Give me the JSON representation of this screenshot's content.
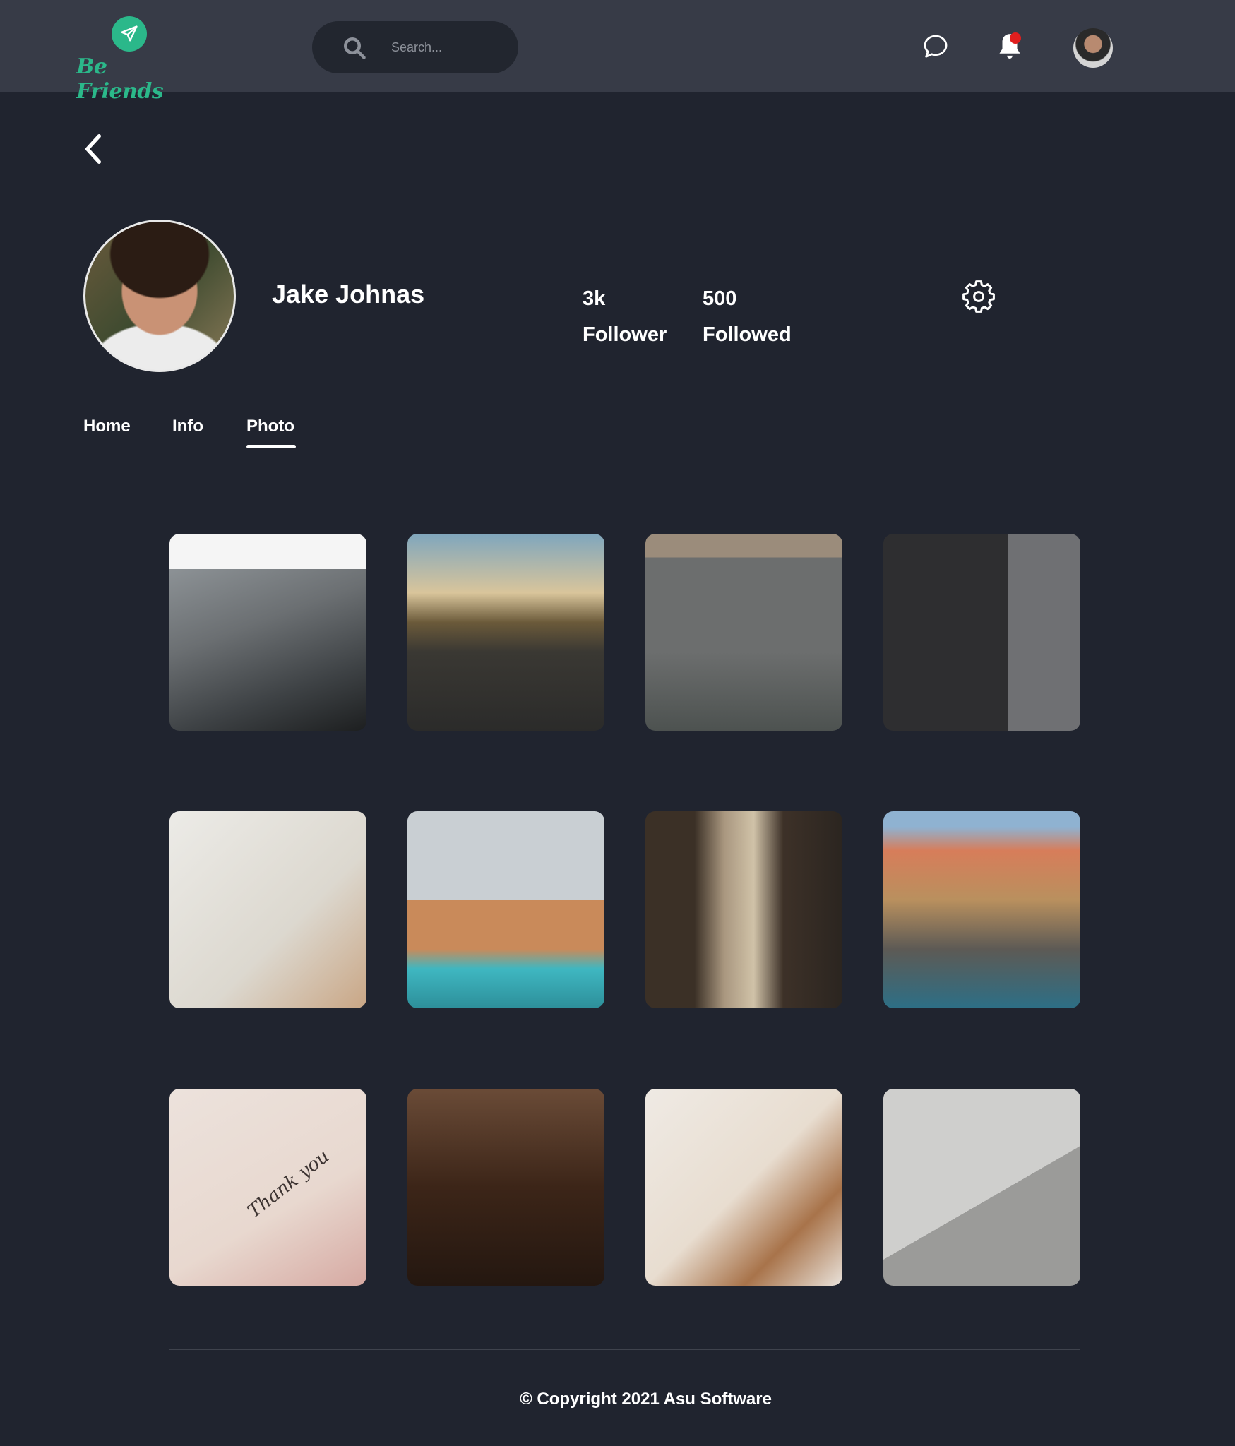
{
  "header": {
    "brand_name": "Be Friends",
    "search": {
      "placeholder": "Search..."
    }
  },
  "profile": {
    "name": "Jake Johnas",
    "stats": [
      {
        "value": "3k",
        "label": "Follower"
      },
      {
        "value": "500",
        "label": "Followed"
      }
    ]
  },
  "tabs": [
    {
      "label": "Home",
      "active": false
    },
    {
      "label": "Info",
      "active": false
    },
    {
      "label": "Photo",
      "active": true
    }
  ],
  "photos": {
    "thank_you_text": "Thank you"
  },
  "footer": {
    "copyright": "© Copyright 2021 Asu Software"
  },
  "colors": {
    "background": "#20242f",
    "header": "#373b47",
    "brand": "#2bb88a",
    "notification_dot": "#e01e1e"
  }
}
